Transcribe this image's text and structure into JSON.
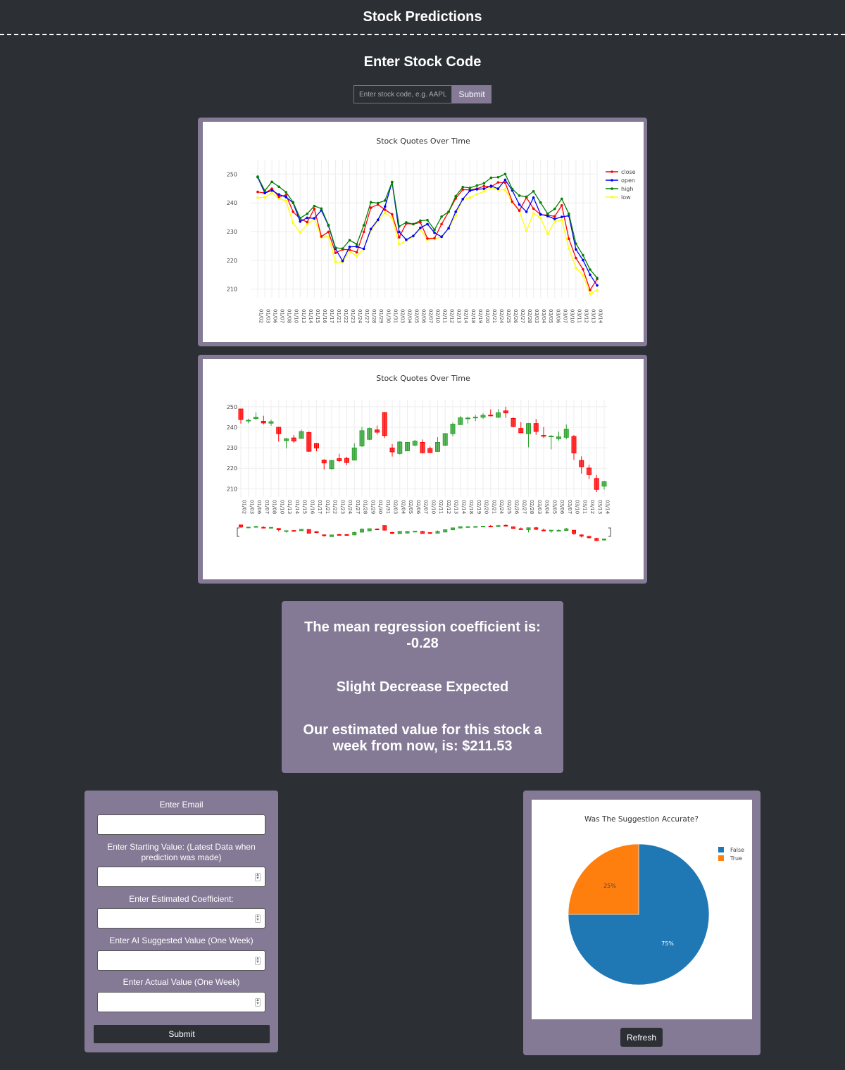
{
  "header": {
    "title": "Stock Predictions"
  },
  "search": {
    "heading": "Enter Stock Code",
    "placeholder": "Enter stock code, e.g. AAPL",
    "submit_label": "Submit"
  },
  "colors": {
    "background": "#2c2f34",
    "card": "#847a96",
    "close": "#ff0000",
    "open": "#0000ff",
    "high": "#008000",
    "low": "#ffff00",
    "increasing": "#2ca02c",
    "decreasing": "#ff0000",
    "pie_false": "#1f77b4",
    "pie_true": "#ff7f0e"
  },
  "chart_data": [
    {
      "type": "line",
      "title": "Stock Quotes Over Time",
      "x": [
        "01/02",
        "01/03",
        "01/06",
        "01/07",
        "01/08",
        "01/10",
        "01/13",
        "01/14",
        "01/15",
        "01/16",
        "01/17",
        "01/21",
        "01/22",
        "01/23",
        "01/24",
        "01/27",
        "01/28",
        "01/29",
        "01/30",
        "01/31",
        "02/03",
        "02/04",
        "02/05",
        "02/06",
        "02/07",
        "02/10",
        "02/11",
        "02/12",
        "02/13",
        "02/14",
        "02/18",
        "02/19",
        "02/20",
        "02/21",
        "02/24",
        "02/25",
        "02/26",
        "02/27",
        "02/28",
        "03/03",
        "03/04",
        "03/05",
        "03/06",
        "03/07",
        "03/10",
        "03/11",
        "03/12",
        "03/13",
        "03/14"
      ],
      "series": [
        {
          "name": "close",
          "values": [
            243.8,
            243.4,
            244.9,
            242.1,
            242.7,
            236.9,
            234.4,
            233.3,
            237.9,
            228.3,
            229.9,
            222.6,
            223.8,
            223.7,
            222.8,
            229.9,
            238.3,
            239.4,
            237.6,
            236.0,
            228.0,
            232.8,
            232.6,
            233.2,
            227.6,
            227.7,
            232.6,
            236.9,
            241.5,
            244.6,
            244.5,
            244.9,
            245.8,
            245.6,
            247.1,
            247.0,
            240.4,
            237.3,
            241.8,
            238.0,
            235.9,
            235.7,
            235.3,
            239.1,
            227.5,
            220.8,
            216.9,
            209.7,
            213.5
          ]
        },
        {
          "name": "open",
          "values": [
            248.9,
            243.4,
            244.3,
            242.9,
            242.0,
            240.0,
            233.5,
            234.8,
            234.6,
            237.4,
            232.1,
            224.0,
            219.8,
            224.7,
            224.8,
            224.0,
            230.9,
            234.1,
            238.7,
            247.2,
            229.9,
            227.2,
            228.5,
            231.3,
            232.6,
            229.6,
            228.2,
            231.2,
            236.9,
            241.3,
            244.2,
            244.7,
            244.9,
            245.9,
            244.9,
            248.0,
            244.3,
            239.4,
            236.9,
            241.8,
            236.0,
            235.4,
            234.4,
            235.1,
            235.5,
            223.8,
            220.1,
            215.0,
            211.3
          ]
        },
        {
          "name": "high",
          "values": [
            249.1,
            244.2,
            247.3,
            245.6,
            243.7,
            240.2,
            234.7,
            236.2,
            238.9,
            238.0,
            232.3,
            224.4,
            224.1,
            227.0,
            225.6,
            232.2,
            240.2,
            239.9,
            240.8,
            247.2,
            231.8,
            233.2,
            232.6,
            233.8,
            234.0,
            230.6,
            235.2,
            236.9,
            242.3,
            245.5,
            245.2,
            246.0,
            246.8,
            248.7,
            248.9,
            250.0,
            244.8,
            242.5,
            242.1,
            244.0,
            240.1,
            236.2,
            237.9,
            241.4,
            236.2,
            225.8,
            221.8,
            216.8,
            213.9
          ]
        },
        {
          "name": "low",
          "values": [
            241.8,
            241.9,
            243.4,
            241.4,
            240.7,
            233.0,
            229.7,
            232.4,
            234.5,
            228.0,
            228.3,
            219.4,
            219.4,
            223.1,
            221.5,
            224.0,
            230.4,
            233.7,
            236.5,
            234.8,
            225.7,
            226.7,
            228.3,
            230.7,
            227.2,
            227.6,
            228.0,
            231.0,
            235.6,
            241.2,
            241.8,
            243.0,
            244.0,
            245.3,
            244.5,
            244.6,
            240.0,
            237.2,
            230.2,
            236.3,
            234.8,
            229.2,
            233.5,
            234.1,
            224.1,
            217.4,
            214.8,
            208.4,
            209.6
          ]
        }
      ],
      "yticks": [
        210,
        220,
        230,
        240,
        250
      ],
      "ylim": [
        207,
        253
      ],
      "legend": "top-right"
    },
    {
      "type": "candlestick",
      "title": "Stock Quotes Over Time",
      "x": [
        "01/02",
        "01/03",
        "01/06",
        "01/07",
        "01/08",
        "01/10",
        "01/13",
        "01/14",
        "01/15",
        "01/16",
        "01/17",
        "01/21",
        "01/22",
        "01/23",
        "01/24",
        "01/27",
        "01/28",
        "01/29",
        "01/30",
        "01/31",
        "02/03",
        "02/04",
        "02/05",
        "02/06",
        "02/07",
        "02/10",
        "02/11",
        "02/12",
        "02/13",
        "02/14",
        "02/18",
        "02/19",
        "02/20",
        "02/21",
        "02/24",
        "02/25",
        "02/26",
        "02/27",
        "02/28",
        "03/03",
        "03/04",
        "03/05",
        "03/06",
        "03/07",
        "03/10",
        "03/11",
        "03/12",
        "03/13",
        "03/14"
      ],
      "open": [
        248.9,
        243.4,
        244.3,
        242.9,
        242.0,
        240.0,
        233.5,
        234.8,
        234.6,
        237.4,
        232.1,
        224.0,
        219.8,
        224.7,
        224.8,
        224.0,
        230.9,
        234.1,
        238.7,
        247.2,
        229.9,
        227.2,
        228.5,
        231.3,
        232.6,
        229.6,
        228.2,
        231.2,
        236.9,
        241.3,
        244.2,
        244.7,
        244.9,
        245.9,
        244.9,
        248.0,
        244.3,
        239.4,
        236.9,
        241.8,
        236.0,
        235.4,
        234.4,
        235.1,
        235.5,
        223.8,
        220.1,
        215.0,
        211.3
      ],
      "high": [
        249.1,
        244.2,
        247.3,
        245.6,
        243.7,
        240.2,
        234.7,
        236.2,
        238.9,
        238.0,
        232.3,
        224.4,
        224.1,
        227.0,
        225.6,
        232.2,
        240.2,
        239.9,
        240.8,
        247.2,
        231.8,
        233.2,
        232.6,
        233.8,
        234.0,
        230.6,
        235.2,
        236.9,
        242.3,
        245.5,
        245.2,
        246.0,
        246.8,
        248.7,
        248.9,
        250.0,
        244.8,
        242.5,
        242.1,
        244.0,
        240.1,
        236.2,
        237.9,
        241.4,
        236.2,
        225.8,
        221.8,
        216.8,
        213.9
      ],
      "low": [
        241.8,
        241.9,
        243.4,
        241.4,
        240.7,
        233.0,
        229.7,
        232.4,
        234.5,
        228.0,
        228.3,
        219.4,
        219.4,
        223.1,
        221.5,
        224.0,
        230.4,
        233.7,
        236.5,
        234.8,
        225.7,
        226.7,
        228.3,
        230.7,
        227.2,
        227.6,
        228.0,
        231.0,
        235.6,
        241.2,
        241.8,
        243.0,
        244.0,
        245.3,
        244.5,
        244.6,
        240.0,
        237.2,
        230.2,
        236.3,
        234.8,
        229.2,
        233.5,
        234.1,
        224.1,
        217.4,
        214.8,
        208.4,
        209.6
      ],
      "close": [
        243.8,
        243.4,
        244.9,
        242.1,
        242.7,
        236.9,
        234.4,
        233.3,
        237.9,
        228.3,
        229.9,
        222.6,
        223.8,
        223.7,
        222.8,
        229.9,
        238.3,
        239.4,
        237.6,
        236.0,
        228.0,
        232.8,
        232.6,
        233.2,
        227.6,
        227.7,
        232.6,
        236.9,
        241.5,
        244.6,
        244.5,
        244.9,
        245.8,
        245.6,
        247.1,
        247.0,
        240.4,
        237.3,
        241.8,
        238.0,
        235.9,
        235.7,
        235.3,
        239.1,
        227.5,
        220.8,
        216.9,
        209.7,
        213.5
      ],
      "yticks": [
        210,
        220,
        230,
        240,
        250
      ],
      "ylim": [
        206,
        252
      ],
      "rangeslider": true
    },
    {
      "type": "pie",
      "title": "Was The Suggestion Accurate?",
      "labels": [
        "False",
        "True"
      ],
      "values": [
        75,
        25
      ],
      "text": [
        "75%",
        "25%"
      ],
      "legend": "top-right"
    }
  ],
  "result": {
    "line1": "The mean regression coefficient is: -0.28",
    "line2": "Slight Decrease Expected",
    "line3": "Our estimated value for this stock a week from now, is: $211.53"
  },
  "form": {
    "email_label": "Enter Email",
    "start_label": "Enter Starting Value: (Latest Data when prediction was made)",
    "coef_label": "Enter Estimated Coefficient:",
    "ai_label": "Enter AI Suggested Value (One Week)",
    "actual_label": "Enter Actual Value (One Week)",
    "submit_label": "Submit"
  },
  "pie_panel": {
    "refresh_label": "Refresh"
  }
}
